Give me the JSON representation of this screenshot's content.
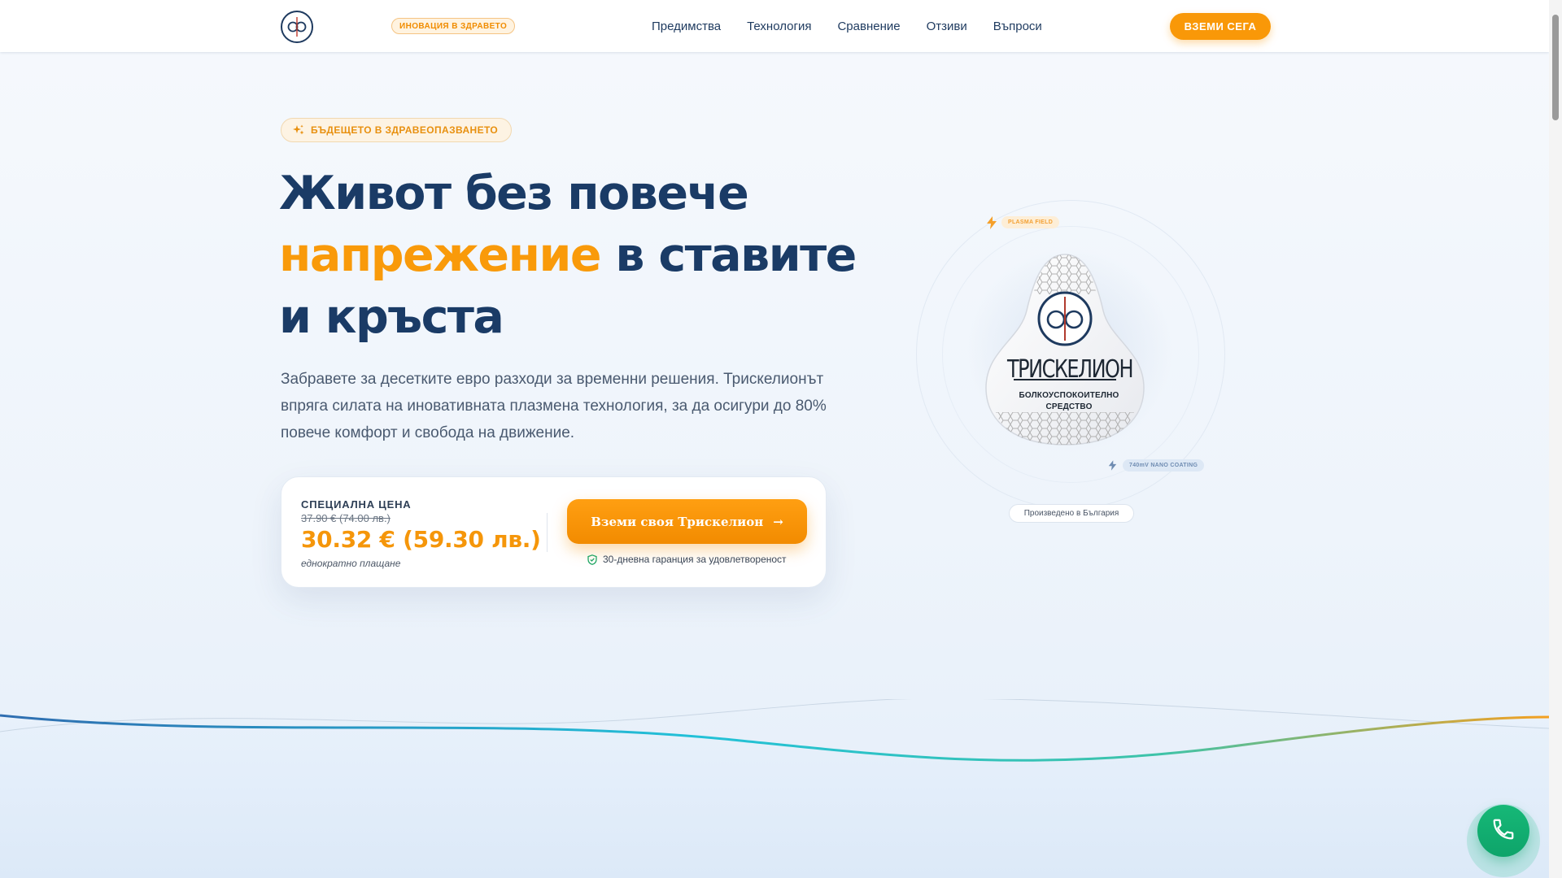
{
  "nav": {
    "logo_icon": "trisk-logo-icon",
    "badge": "ИНОВАЦИЯ В ЗДРАВЕТО",
    "links": [
      "Предимства",
      "Технология",
      "Сравнение",
      "Отзиви",
      "Въпроси"
    ],
    "cta": "ВЗЕМИ СЕГА"
  },
  "hero": {
    "tag": "БЪДЕЩЕТО В ЗДРАВЕОПАЗВАНЕТО",
    "title_part1": "Живот без повече",
    "title_accent": "напрежение",
    "title_part2": "в ставите",
    "title_part3": "и кръста",
    "description": "Забравете за десетките евро разходи за временни решения. Трискелионът впряга силата на иновативната плазмена технология, за да осигури до 80% повече комфорт и свобода на движение."
  },
  "price_card": {
    "label": "СПЕЦИАЛНА ЦЕНА",
    "old_price": "37.90 € (74.00 лв.)",
    "new_price": "30.32 € (59.30 лв.)",
    "note": "еднократно плащане",
    "button": "Вземи своя Трискелион",
    "guarantee": "30-дневна гаранция за удовлетвореност"
  },
  "product": {
    "brand": "ТРИСКЕЛИОН",
    "subtitle": "БОЛКОУСПОКОИТЕЛНО СРЕДСТВО",
    "badge_plasma": "PLASMA FIELD",
    "badge_nano": "740mV NANO COATING",
    "made_in": "Произведено в България"
  },
  "colors": {
    "primary": "#1a3b66",
    "accent": "#f99a0a",
    "call": "#16b877"
  }
}
